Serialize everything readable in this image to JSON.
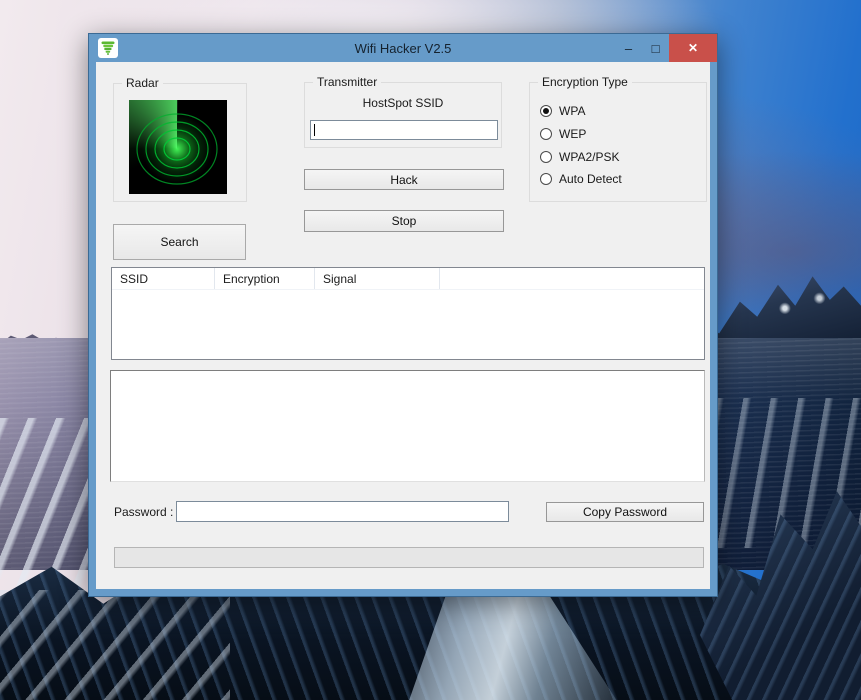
{
  "window": {
    "title": "Wifi Hacker V2.5",
    "icons": {
      "app": "green-wifi-vortex-icon",
      "minimize": "–",
      "maximize": "□",
      "close": "✕"
    }
  },
  "groups": {
    "radar": {
      "label": "Radar"
    },
    "transmitter": {
      "label": "Transmitter",
      "ssid_label": "HostSpot SSID",
      "ssid_value": ""
    },
    "encryption": {
      "label": "Encryption Type",
      "options": [
        {
          "label": "WPA",
          "selected": true
        },
        {
          "label": "WEP",
          "selected": false
        },
        {
          "label": "WPA2/PSK",
          "selected": false
        },
        {
          "label": "Auto Detect",
          "selected": false
        }
      ]
    }
  },
  "buttons": {
    "hack": "Hack",
    "stop": "Stop",
    "search": "Search",
    "copy_password": "Copy Password"
  },
  "list": {
    "columns": [
      "SSID",
      "Encryption",
      "Signal"
    ],
    "rows": []
  },
  "output": {
    "text": ""
  },
  "password": {
    "label": "Password :",
    "value": ""
  },
  "progress": {
    "value_percent": 0
  },
  "colors": {
    "titlebar_blue": "#669bc9",
    "window_border_blue": "#669bc9",
    "close_red": "#c9504a",
    "client_gray": "#f0f0f0",
    "radar_green": "#1ec832"
  }
}
